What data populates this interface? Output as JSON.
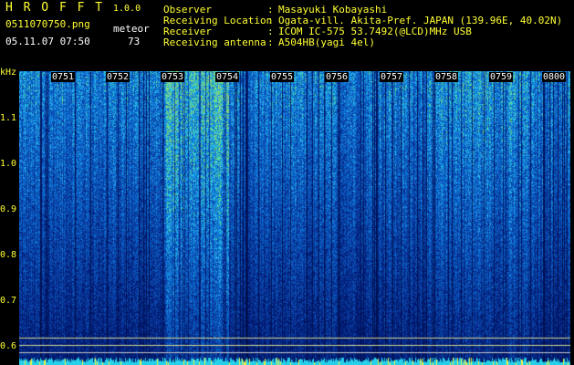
{
  "header": {
    "app_title": "H R O F F T",
    "app_version": "1.0.0",
    "filename": "0511070750.png",
    "datetime": "05.11.07 07:50",
    "mode_label": "meteor",
    "count_value": "73"
  },
  "metadata": [
    {
      "key": "Observer",
      "value": "Masayuki Kobayashi"
    },
    {
      "key": "Receiving Location",
      "value": "Ogata-vill. Akita-Pref. JAPAN (139.96E, 40.02N)"
    },
    {
      "key": "Receiver",
      "value": "ICOM IC-575 53.7492(@LCD)MHz USB"
    },
    {
      "key": "Receiving antenna",
      "value": "A504HB(yagi 4el)"
    }
  ],
  "axis": {
    "freq_unit": "kHz",
    "freq_ticks": [
      "1.1",
      "1.0",
      "0.9",
      "0.8",
      "0.7",
      "0.6"
    ],
    "time_ticks": [
      "0751",
      "0752",
      "0753",
      "0754",
      "0755",
      "0756",
      "0757",
      "0758",
      "0759",
      "0800"
    ]
  },
  "colors": {
    "header_text": "#ffff33",
    "background": "#000000",
    "signal_low": "#00154d",
    "signal_mid": "#2a6fd6",
    "signal_high": "#7cf05a"
  }
}
